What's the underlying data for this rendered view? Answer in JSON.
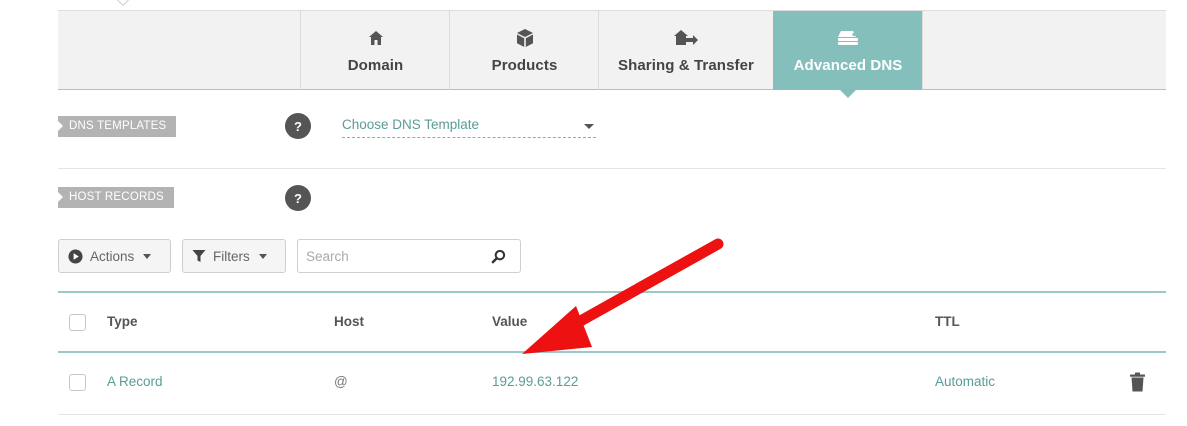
{
  "tabs": [
    {
      "label": "Domain",
      "icon": "home-icon",
      "active": false
    },
    {
      "label": "Products",
      "icon": "box-icon",
      "active": false
    },
    {
      "label": "Sharing & Transfer",
      "icon": "house-transfer-icon",
      "active": false
    },
    {
      "label": "Advanced DNS",
      "icon": "server-icon",
      "active": true
    }
  ],
  "dns_templates": {
    "label": "DNS TEMPLATES",
    "help": "?",
    "select_value": "Choose DNS Template"
  },
  "host_records": {
    "label": "HOST RECORDS",
    "help": "?"
  },
  "toolbar": {
    "actions_label": "Actions",
    "filters_label": "Filters",
    "search_placeholder": "Search"
  },
  "table": {
    "columns": [
      "Type",
      "Host",
      "Value",
      "TTL"
    ],
    "rows": [
      {
        "type": "A Record",
        "host": "@",
        "value": "192.99.63.122",
        "ttl": "Automatic"
      }
    ]
  },
  "colors": {
    "accent": "#85bfbb",
    "link": "#5a9c97",
    "annotation_arrow": "#ee1111"
  }
}
